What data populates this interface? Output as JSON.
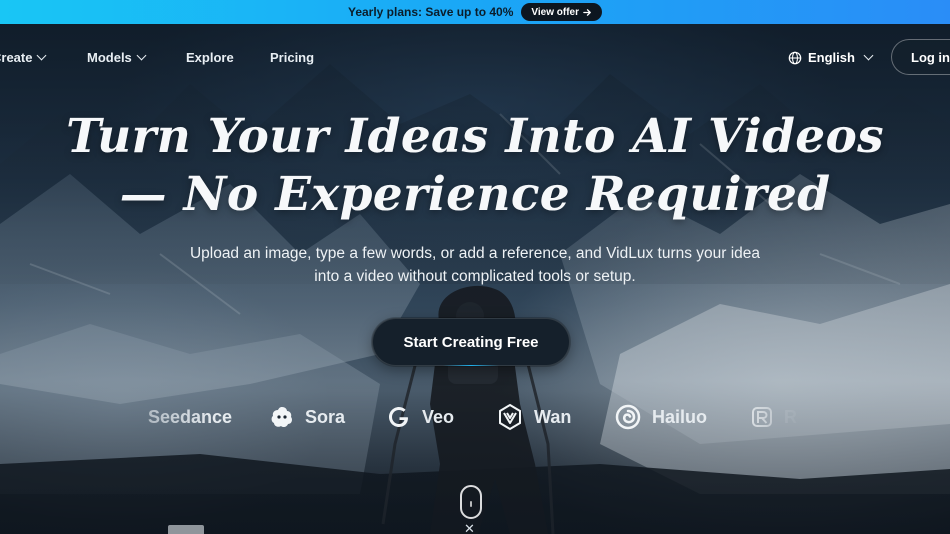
{
  "promo": {
    "text": "Yearly plans: Save up to 40%",
    "button_label": "View offer",
    "button_icon": "arrow-right-icon"
  },
  "nav": {
    "items": [
      {
        "label": "Create",
        "has_dropdown": true
      },
      {
        "label": "Models",
        "has_dropdown": true
      },
      {
        "label": "Explore",
        "has_dropdown": false
      },
      {
        "label": "Pricing",
        "has_dropdown": false
      }
    ],
    "language": {
      "icon": "globe-icon",
      "label": "English"
    },
    "login_label": "Log in"
  },
  "hero": {
    "headline_line1": "Turn Your Ideas Into AI Videos",
    "headline_line2": "— No Experience Required",
    "subtitle_line1": "Upload an image, type a few words, or add a reference, and VidLux turns your idea",
    "subtitle_line2": "into a video without complicated tools or setup.",
    "cta_label": "Start Creating Free"
  },
  "models": [
    {
      "name": "Seedance",
      "icon": ""
    },
    {
      "name": "Sora",
      "icon": "sora-icon"
    },
    {
      "name": "Veo",
      "icon": "google-g-icon"
    },
    {
      "name": "Wan",
      "icon": "wan-icon"
    },
    {
      "name": "Hailuo",
      "icon": "hailuo-icon"
    },
    {
      "name": "R",
      "icon": "r-logo-icon"
    }
  ],
  "colors": {
    "promo_gradient_start": "#19c6f5",
    "promo_gradient_end": "#2a8df7",
    "cta_bg": "#15202b"
  }
}
